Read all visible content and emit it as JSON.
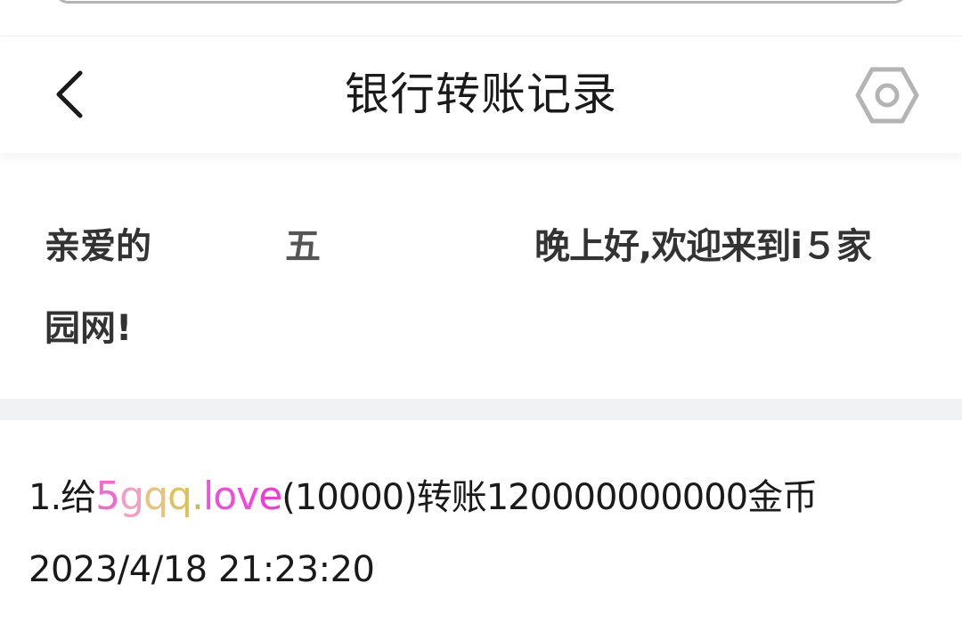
{
  "header": {
    "title": "银行转账记录",
    "back_icon": "chevron-left-icon",
    "settings_icon": "hexagon-gear-icon"
  },
  "greeting": {
    "prefix": "亲爱的",
    "name": "五",
    "suffix": "晚上好,欢迎来到i５家",
    "line2": "园网!"
  },
  "records": [
    {
      "index": "1.",
      "action_prefix": "给",
      "recipient_chars": [
        "5",
        "g",
        "q",
        "q",
        ".",
        "l",
        "o",
        "v",
        "e"
      ],
      "recipient_colors": [
        "#f26ad0",
        "#f39fc1",
        "#e8c37f",
        "#dfc35a",
        "#b5c16e",
        "#e45ad5",
        "#ee4fd9",
        "#f446d8",
        "#f03ed3"
      ],
      "recipient_id": "(10000)",
      "action": "转账",
      "amount": "120000000000",
      "unit": "金币",
      "timestamp": "2023/4/18 21:23:20"
    }
  ],
  "colors": {
    "divider": "#f1f2f4",
    "icon_gray": "#b4b4b4"
  }
}
